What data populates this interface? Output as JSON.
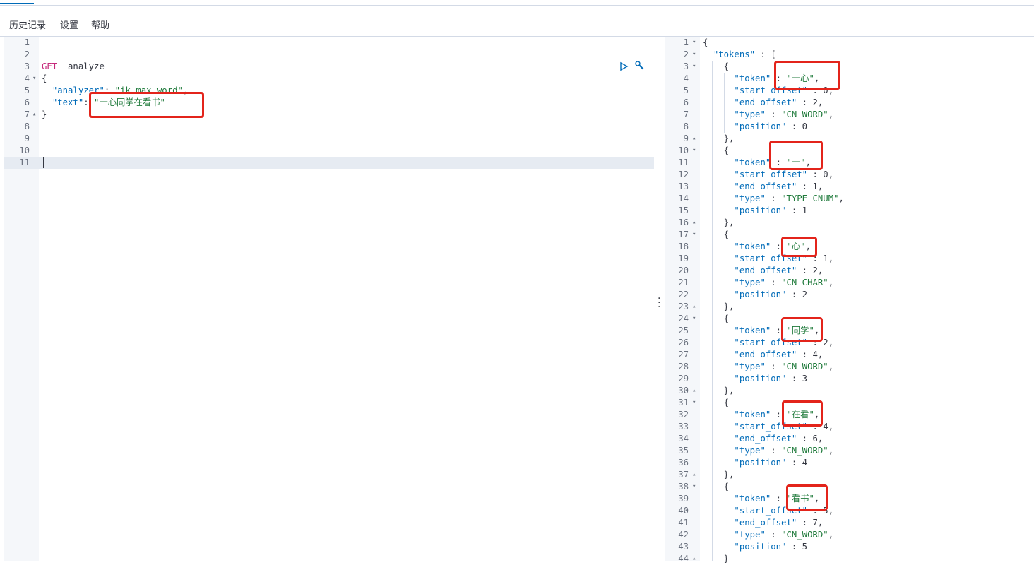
{
  "menu": [
    "历史记录",
    "设置",
    "帮助"
  ],
  "left_lines": [
    {
      "n": "1",
      "fold": "",
      "parts": []
    },
    {
      "n": "2",
      "fold": "",
      "parts": []
    },
    {
      "n": "3",
      "fold": "",
      "parts": [
        {
          "c": "kw-method",
          "t": "GET"
        },
        {
          "c": "",
          "t": " _analyze"
        }
      ]
    },
    {
      "n": "4",
      "fold": "▾",
      "parts": [
        {
          "c": "",
          "t": "{"
        }
      ]
    },
    {
      "n": "5",
      "fold": "",
      "parts": [
        {
          "c": "",
          "t": "  "
        },
        {
          "c": "kw-key",
          "t": "\"analyzer\""
        },
        {
          "c": "",
          "t": ": "
        },
        {
          "c": "kw-str",
          "t": "\"ik_max_word\""
        },
        {
          "c": "",
          "t": ","
        }
      ]
    },
    {
      "n": "6",
      "fold": "",
      "parts": [
        {
          "c": "",
          "t": "  "
        },
        {
          "c": "kw-key",
          "t": "\"text\""
        },
        {
          "c": "",
          "t": ": "
        },
        {
          "c": "kw-str",
          "t": "\"一心同学在看书\""
        }
      ]
    },
    {
      "n": "7",
      "fold": "▴",
      "parts": [
        {
          "c": "",
          "t": "}"
        }
      ]
    },
    {
      "n": "8",
      "fold": "",
      "parts": []
    },
    {
      "n": "9",
      "fold": "",
      "parts": []
    },
    {
      "n": "10",
      "fold": "",
      "parts": []
    },
    {
      "n": "11",
      "fold": "",
      "parts": []
    }
  ],
  "right_lines": [
    {
      "n": "1",
      "fold": "▾",
      "parts": [
        {
          "c": "",
          "t": "{"
        }
      ]
    },
    {
      "n": "2",
      "fold": "▾",
      "parts": [
        {
          "c": "",
          "t": "  "
        },
        {
          "c": "kw-key",
          "t": "\"tokens\""
        },
        {
          "c": "",
          "t": " : ["
        }
      ]
    },
    {
      "n": "3",
      "fold": "▾",
      "parts": [
        {
          "c": "",
          "t": "    {"
        }
      ]
    },
    {
      "n": "4",
      "fold": "",
      "parts": [
        {
          "c": "",
          "t": "      "
        },
        {
          "c": "kw-key",
          "t": "\"token\""
        },
        {
          "c": "",
          "t": " : "
        },
        {
          "c": "kw-str",
          "t": "\"一心\""
        },
        {
          "c": "",
          "t": ","
        }
      ]
    },
    {
      "n": "5",
      "fold": "",
      "parts": [
        {
          "c": "",
          "t": "      "
        },
        {
          "c": "kw-key",
          "t": "\"start_offset\""
        },
        {
          "c": "",
          "t": " : 0,"
        }
      ]
    },
    {
      "n": "6",
      "fold": "",
      "parts": [
        {
          "c": "",
          "t": "      "
        },
        {
          "c": "kw-key",
          "t": "\"end_offset\""
        },
        {
          "c": "",
          "t": " : 2,"
        }
      ]
    },
    {
      "n": "7",
      "fold": "",
      "parts": [
        {
          "c": "",
          "t": "      "
        },
        {
          "c": "kw-key",
          "t": "\"type\""
        },
        {
          "c": "",
          "t": " : "
        },
        {
          "c": "kw-str",
          "t": "\"CN_WORD\""
        },
        {
          "c": "",
          "t": ","
        }
      ]
    },
    {
      "n": "8",
      "fold": "",
      "parts": [
        {
          "c": "",
          "t": "      "
        },
        {
          "c": "kw-key",
          "t": "\"position\""
        },
        {
          "c": "",
          "t": " : 0"
        }
      ]
    },
    {
      "n": "9",
      "fold": "▴",
      "parts": [
        {
          "c": "",
          "t": "    },"
        }
      ]
    },
    {
      "n": "10",
      "fold": "▾",
      "parts": [
        {
          "c": "",
          "t": "    {"
        }
      ]
    },
    {
      "n": "11",
      "fold": "",
      "parts": [
        {
          "c": "",
          "t": "      "
        },
        {
          "c": "kw-key",
          "t": "\"token\""
        },
        {
          "c": "",
          "t": " : "
        },
        {
          "c": "kw-str",
          "t": "\"一\""
        },
        {
          "c": "",
          "t": ","
        }
      ]
    },
    {
      "n": "12",
      "fold": "",
      "parts": [
        {
          "c": "",
          "t": "      "
        },
        {
          "c": "kw-key",
          "t": "\"start_offset\""
        },
        {
          "c": "",
          "t": " : 0,"
        }
      ]
    },
    {
      "n": "13",
      "fold": "",
      "parts": [
        {
          "c": "",
          "t": "      "
        },
        {
          "c": "kw-key",
          "t": "\"end_offset\""
        },
        {
          "c": "",
          "t": " : 1,"
        }
      ]
    },
    {
      "n": "14",
      "fold": "",
      "parts": [
        {
          "c": "",
          "t": "      "
        },
        {
          "c": "kw-key",
          "t": "\"type\""
        },
        {
          "c": "",
          "t": " : "
        },
        {
          "c": "kw-str",
          "t": "\"TYPE_CNUM\""
        },
        {
          "c": "",
          "t": ","
        }
      ]
    },
    {
      "n": "15",
      "fold": "",
      "parts": [
        {
          "c": "",
          "t": "      "
        },
        {
          "c": "kw-key",
          "t": "\"position\""
        },
        {
          "c": "",
          "t": " : 1"
        }
      ]
    },
    {
      "n": "16",
      "fold": "▴",
      "parts": [
        {
          "c": "",
          "t": "    },"
        }
      ]
    },
    {
      "n": "17",
      "fold": "▾",
      "parts": [
        {
          "c": "",
          "t": "    {"
        }
      ]
    },
    {
      "n": "18",
      "fold": "",
      "parts": [
        {
          "c": "",
          "t": "      "
        },
        {
          "c": "kw-key",
          "t": "\"token\""
        },
        {
          "c": "",
          "t": " : "
        },
        {
          "c": "kw-str",
          "t": "\"心\""
        },
        {
          "c": "",
          "t": ","
        }
      ]
    },
    {
      "n": "19",
      "fold": "",
      "parts": [
        {
          "c": "",
          "t": "      "
        },
        {
          "c": "kw-key",
          "t": "\"start_offset\""
        },
        {
          "c": "",
          "t": " : 1,"
        }
      ]
    },
    {
      "n": "20",
      "fold": "",
      "parts": [
        {
          "c": "",
          "t": "      "
        },
        {
          "c": "kw-key",
          "t": "\"end_offset\""
        },
        {
          "c": "",
          "t": " : 2,"
        }
      ]
    },
    {
      "n": "21",
      "fold": "",
      "parts": [
        {
          "c": "",
          "t": "      "
        },
        {
          "c": "kw-key",
          "t": "\"type\""
        },
        {
          "c": "",
          "t": " : "
        },
        {
          "c": "kw-str",
          "t": "\"CN_CHAR\""
        },
        {
          "c": "",
          "t": ","
        }
      ]
    },
    {
      "n": "22",
      "fold": "",
      "parts": [
        {
          "c": "",
          "t": "      "
        },
        {
          "c": "kw-key",
          "t": "\"position\""
        },
        {
          "c": "",
          "t": " : 2"
        }
      ]
    },
    {
      "n": "23",
      "fold": "▴",
      "parts": [
        {
          "c": "",
          "t": "    },"
        }
      ]
    },
    {
      "n": "24",
      "fold": "▾",
      "parts": [
        {
          "c": "",
          "t": "    {"
        }
      ]
    },
    {
      "n": "25",
      "fold": "",
      "parts": [
        {
          "c": "",
          "t": "      "
        },
        {
          "c": "kw-key",
          "t": "\"token\""
        },
        {
          "c": "",
          "t": " : "
        },
        {
          "c": "kw-str",
          "t": "\"同学\""
        },
        {
          "c": "",
          "t": ","
        }
      ]
    },
    {
      "n": "26",
      "fold": "",
      "parts": [
        {
          "c": "",
          "t": "      "
        },
        {
          "c": "kw-key",
          "t": "\"start_offset\""
        },
        {
          "c": "",
          "t": " : 2,"
        }
      ]
    },
    {
      "n": "27",
      "fold": "",
      "parts": [
        {
          "c": "",
          "t": "      "
        },
        {
          "c": "kw-key",
          "t": "\"end_offset\""
        },
        {
          "c": "",
          "t": " : 4,"
        }
      ]
    },
    {
      "n": "28",
      "fold": "",
      "parts": [
        {
          "c": "",
          "t": "      "
        },
        {
          "c": "kw-key",
          "t": "\"type\""
        },
        {
          "c": "",
          "t": " : "
        },
        {
          "c": "kw-str",
          "t": "\"CN_WORD\""
        },
        {
          "c": "",
          "t": ","
        }
      ]
    },
    {
      "n": "29",
      "fold": "",
      "parts": [
        {
          "c": "",
          "t": "      "
        },
        {
          "c": "kw-key",
          "t": "\"position\""
        },
        {
          "c": "",
          "t": " : 3"
        }
      ]
    },
    {
      "n": "30",
      "fold": "▴",
      "parts": [
        {
          "c": "",
          "t": "    },"
        }
      ]
    },
    {
      "n": "31",
      "fold": "▾",
      "parts": [
        {
          "c": "",
          "t": "    {"
        }
      ]
    },
    {
      "n": "32",
      "fold": "",
      "parts": [
        {
          "c": "",
          "t": "      "
        },
        {
          "c": "kw-key",
          "t": "\"token\""
        },
        {
          "c": "",
          "t": " : "
        },
        {
          "c": "kw-str",
          "t": "\"在看\""
        },
        {
          "c": "",
          "t": ","
        }
      ]
    },
    {
      "n": "33",
      "fold": "",
      "parts": [
        {
          "c": "",
          "t": "      "
        },
        {
          "c": "kw-key",
          "t": "\"start_offset\""
        },
        {
          "c": "",
          "t": " : 4,"
        }
      ]
    },
    {
      "n": "34",
      "fold": "",
      "parts": [
        {
          "c": "",
          "t": "      "
        },
        {
          "c": "kw-key",
          "t": "\"end_offset\""
        },
        {
          "c": "",
          "t": " : 6,"
        }
      ]
    },
    {
      "n": "35",
      "fold": "",
      "parts": [
        {
          "c": "",
          "t": "      "
        },
        {
          "c": "kw-key",
          "t": "\"type\""
        },
        {
          "c": "",
          "t": " : "
        },
        {
          "c": "kw-str",
          "t": "\"CN_WORD\""
        },
        {
          "c": "",
          "t": ","
        }
      ]
    },
    {
      "n": "36",
      "fold": "",
      "parts": [
        {
          "c": "",
          "t": "      "
        },
        {
          "c": "kw-key",
          "t": "\"position\""
        },
        {
          "c": "",
          "t": " : 4"
        }
      ]
    },
    {
      "n": "37",
      "fold": "▴",
      "parts": [
        {
          "c": "",
          "t": "    },"
        }
      ]
    },
    {
      "n": "38",
      "fold": "▾",
      "parts": [
        {
          "c": "",
          "t": "    {"
        }
      ]
    },
    {
      "n": "39",
      "fold": "",
      "parts": [
        {
          "c": "",
          "t": "      "
        },
        {
          "c": "kw-key",
          "t": "\"token\""
        },
        {
          "c": "",
          "t": " : "
        },
        {
          "c": "kw-str",
          "t": "\"看书\""
        },
        {
          "c": "",
          "t": ","
        }
      ]
    },
    {
      "n": "40",
      "fold": "",
      "parts": [
        {
          "c": "",
          "t": "      "
        },
        {
          "c": "kw-key",
          "t": "\"start_offset\""
        },
        {
          "c": "",
          "t": " : 5,"
        }
      ]
    },
    {
      "n": "41",
      "fold": "",
      "parts": [
        {
          "c": "",
          "t": "      "
        },
        {
          "c": "kw-key",
          "t": "\"end_offset\""
        },
        {
          "c": "",
          "t": " : 7,"
        }
      ]
    },
    {
      "n": "42",
      "fold": "",
      "parts": [
        {
          "c": "",
          "t": "      "
        },
        {
          "c": "kw-key",
          "t": "\"type\""
        },
        {
          "c": "",
          "t": " : "
        },
        {
          "c": "kw-str",
          "t": "\"CN_WORD\""
        },
        {
          "c": "",
          "t": ","
        }
      ]
    },
    {
      "n": "43",
      "fold": "",
      "parts": [
        {
          "c": "",
          "t": "      "
        },
        {
          "c": "kw-key",
          "t": "\"position\""
        },
        {
          "c": "",
          "t": " : 5"
        }
      ]
    },
    {
      "n": "44",
      "fold": "▴",
      "parts": [
        {
          "c": "",
          "t": "    }"
        }
      ]
    }
  ],
  "active_line": 11,
  "icons": {
    "run": "play-icon",
    "settings": "wrench-icon",
    "resize": "vertical-dots-icon"
  },
  "colors": {
    "method": "#c5287a",
    "string": "#1f7a3b",
    "key": "#006bb8",
    "highlight": "#e3241b"
  }
}
